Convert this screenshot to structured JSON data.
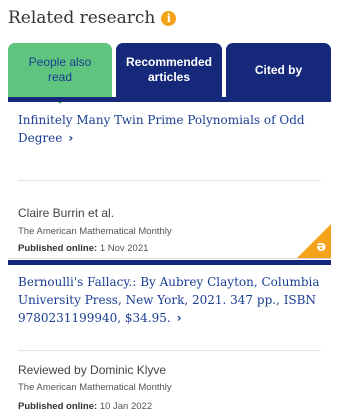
{
  "header": {
    "title": "Related research",
    "info_icon": "i"
  },
  "tabs": [
    {
      "label_line1": "People also",
      "label_line2": "read",
      "active": true
    },
    {
      "label_line1": "Recommended",
      "label_line2": "articles",
      "active": false
    },
    {
      "label_line1": "Cited by",
      "label_line2": "",
      "active": false
    }
  ],
  "articles": [
    {
      "title": "Infinitely Many Twin Prime Polynomials of Odd Degree",
      "author": "Claire Burrin et al.",
      "journal": "The American Mathematical Monthly",
      "published_label": "Published online:",
      "published_date": "1 Nov 2021",
      "open_access_icon": "open-access-icon",
      "open_access_glyph": "ə"
    },
    {
      "title": "Bernoulli's Fallacy.: By Aubrey Clayton, Columbia University Press, New York, 2021. 347 pp., ISBN 9780231199940, $34.95.",
      "author": "Reviewed by Dominic Klyve",
      "journal": "The American Mathematical Monthly",
      "published_label": "Published online:",
      "published_date": "10 Jan 2022"
    }
  ],
  "chevron": "›",
  "colors": {
    "navy": "#15287a",
    "green": "#5fc47e",
    "orange": "#f5a21b",
    "link": "#1a3e93"
  }
}
